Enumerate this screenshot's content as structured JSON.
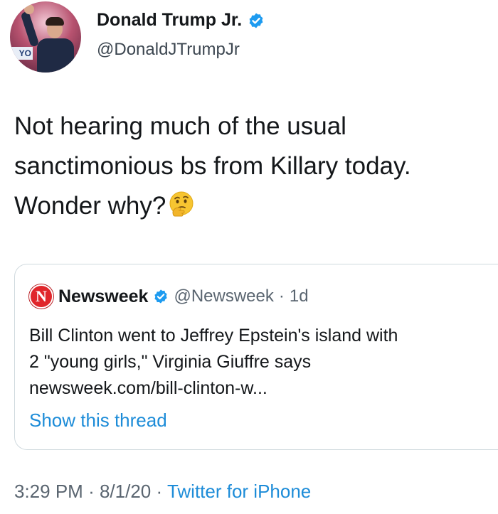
{
  "author": {
    "display_name": "Donald Trump Jr.",
    "handle": "@DonaldJTrumpJr",
    "avatar_stage_text": "YO",
    "verified_icon": "verified-badge-icon"
  },
  "tweet": {
    "lines": [
      "Not hearing much of the usual",
      "sanctimonious bs from Killary today.",
      "Wonder why?"
    ],
    "emoji": "thinking-face-icon"
  },
  "quoted": {
    "logo_letter": "N",
    "name": "Newsweek",
    "handle": "@Newsweek",
    "separator": "·",
    "age": "1d",
    "lines": [
      "Bill Clinton went to Jeffrey Epstein's island with",
      "2 \"young girls,\" Virginia Giuffre says",
      "newsweek.com/bill-clinton-w..."
    ],
    "show_thread": "Show this thread"
  },
  "meta": {
    "time": "3:29 PM",
    "sep1": "·",
    "date": "8/1/20",
    "sep2": "·",
    "source": "Twitter for iPhone"
  },
  "colors": {
    "link": "#1d8cd8",
    "verified": "#1d9bf0",
    "newsweek_red": "#e0262b"
  }
}
